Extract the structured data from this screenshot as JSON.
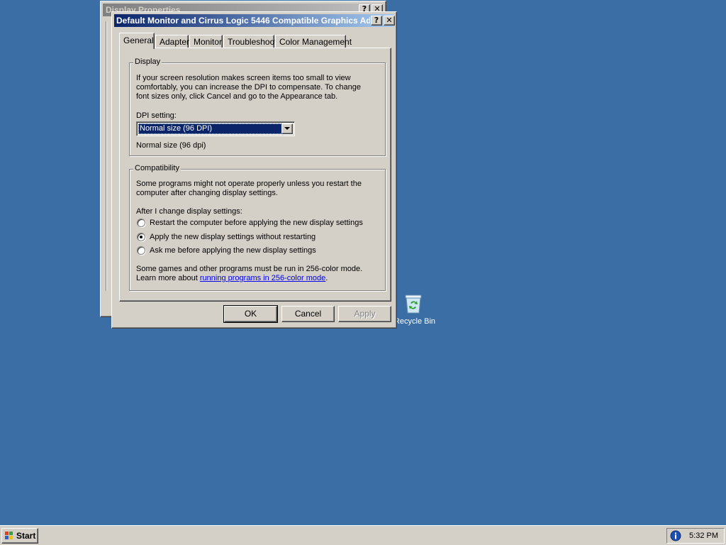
{
  "background_window": {
    "title": "Display Properties",
    "help_btn": "?",
    "close_btn": "✕"
  },
  "dialog": {
    "title": "Default Monitor and Cirrus Logic 5446 Compatible Graphics Ad...",
    "help_btn": "?",
    "close_btn": "✕",
    "tabs": [
      {
        "label": "General",
        "active": true
      },
      {
        "label": "Adapter"
      },
      {
        "label": "Monitor"
      },
      {
        "label": "Troubleshoot"
      },
      {
        "label": "Color Management"
      }
    ],
    "display_group": {
      "legend": "Display",
      "description_lines": [
        "If your screen resolution makes screen items too small to view",
        "comfortably, you can increase the DPI to compensate.  To change",
        "font sizes only, click Cancel and go to the Appearance tab."
      ],
      "dpi_label": "DPI setting:",
      "dpi_selected": "Normal size (96 DPI)",
      "dpi_caption": "Normal size (96 dpi)"
    },
    "compat_group": {
      "legend": "Compatibility",
      "description_lines": [
        "Some programs might not operate properly unless you restart the",
        "computer after changing display settings."
      ],
      "after_label": "After I change display settings:",
      "options": [
        {
          "label": "Restart the computer before applying the new display settings",
          "checked": false
        },
        {
          "label": "Apply the new display settings without restarting",
          "checked": true
        },
        {
          "label": "Ask me before applying the new display settings",
          "checked": false
        }
      ],
      "note_line1": "Some games and other programs must be run in 256-color mode.",
      "note_line2_prefix": "Learn more about ",
      "note_link": "running programs in 256-color mode",
      "note_suffix": "."
    },
    "buttons": {
      "ok": "OK",
      "cancel": "Cancel",
      "apply": "Apply"
    }
  },
  "desktop": {
    "recycle_bin_label": "Recycle Bin"
  },
  "taskbar": {
    "start_label": "Start",
    "clock": "5:32 PM",
    "tray_icon": "info-icon"
  },
  "colors": {
    "desktop": "#3a6ea5",
    "title_active_start": "#0a246a",
    "title_active_end": "#a6caf0",
    "face": "#d4d0c8"
  }
}
